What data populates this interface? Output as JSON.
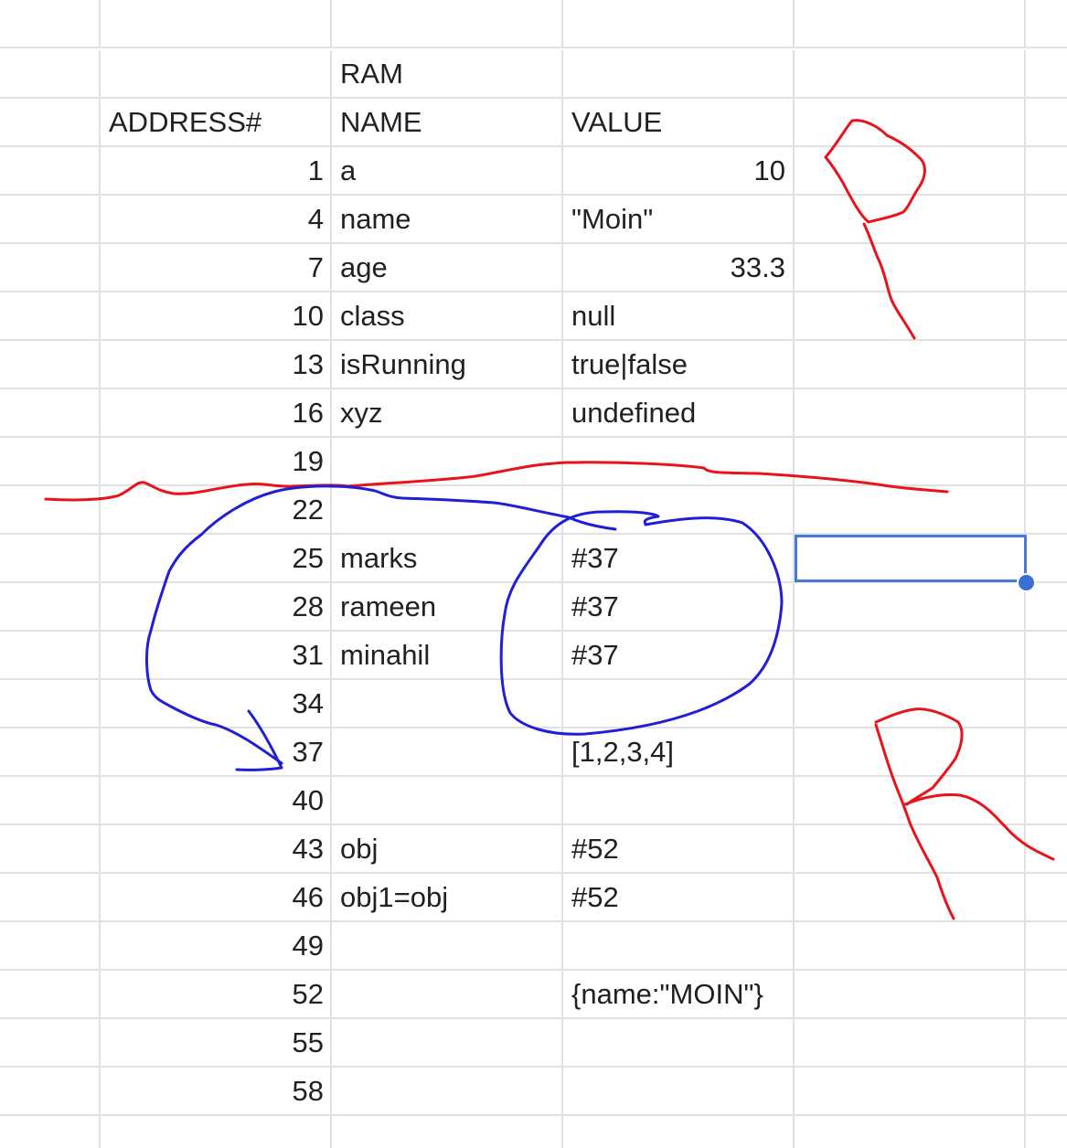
{
  "sheet": {
    "title": "RAM",
    "headers": {
      "address": "ADDRESS#",
      "name": "NAME",
      "value": "VALUE"
    },
    "rows": [
      {
        "address": "1",
        "name": "a",
        "value": "10"
      },
      {
        "address": "4",
        "name": "name",
        "value": "\"Moin\""
      },
      {
        "address": "7",
        "name": "age",
        "value": "33.3"
      },
      {
        "address": "10",
        "name": "class",
        "value": "null"
      },
      {
        "address": "13",
        "name": "isRunning",
        "value": "true|false"
      },
      {
        "address": "16",
        "name": "xyz",
        "value": "undefined"
      },
      {
        "address": "19",
        "name": "",
        "value": ""
      },
      {
        "address": "22",
        "name": "",
        "value": ""
      },
      {
        "address": "25",
        "name": "marks",
        "value": "#37"
      },
      {
        "address": "28",
        "name": "rameen",
        "value": "#37"
      },
      {
        "address": "31",
        "name": "minahil",
        "value": "#37"
      },
      {
        "address": "34",
        "name": "",
        "value": ""
      },
      {
        "address": "37",
        "name": "",
        "value": "[1,2,3,4]"
      },
      {
        "address": "40",
        "name": "",
        "value": ""
      },
      {
        "address": "43",
        "name": "obj",
        "value": "#52"
      },
      {
        "address": "46",
        "name": "obj1=obj",
        "value": "#52"
      },
      {
        "address": "49",
        "name": "",
        "value": ""
      },
      {
        "address": "52",
        "name": "",
        "value": "{name:\"MOIN\"}"
      },
      {
        "address": "55",
        "name": "",
        "value": ""
      },
      {
        "address": "58",
        "name": "",
        "value": ""
      }
    ]
  },
  "colors": {
    "gridline": "#e1e1e1",
    "text": "#202124",
    "selection": "#4a78d8",
    "annotation_red": "#e8141b",
    "annotation_blue": "#1f1fd6"
  },
  "annotations": {
    "red_divider": "red-freehand-line",
    "blue_loop": "blue-freehand-arrow",
    "red_letter_top": "red-freehand-letter-p",
    "red_letter_bottom": "red-freehand-letter-r"
  }
}
